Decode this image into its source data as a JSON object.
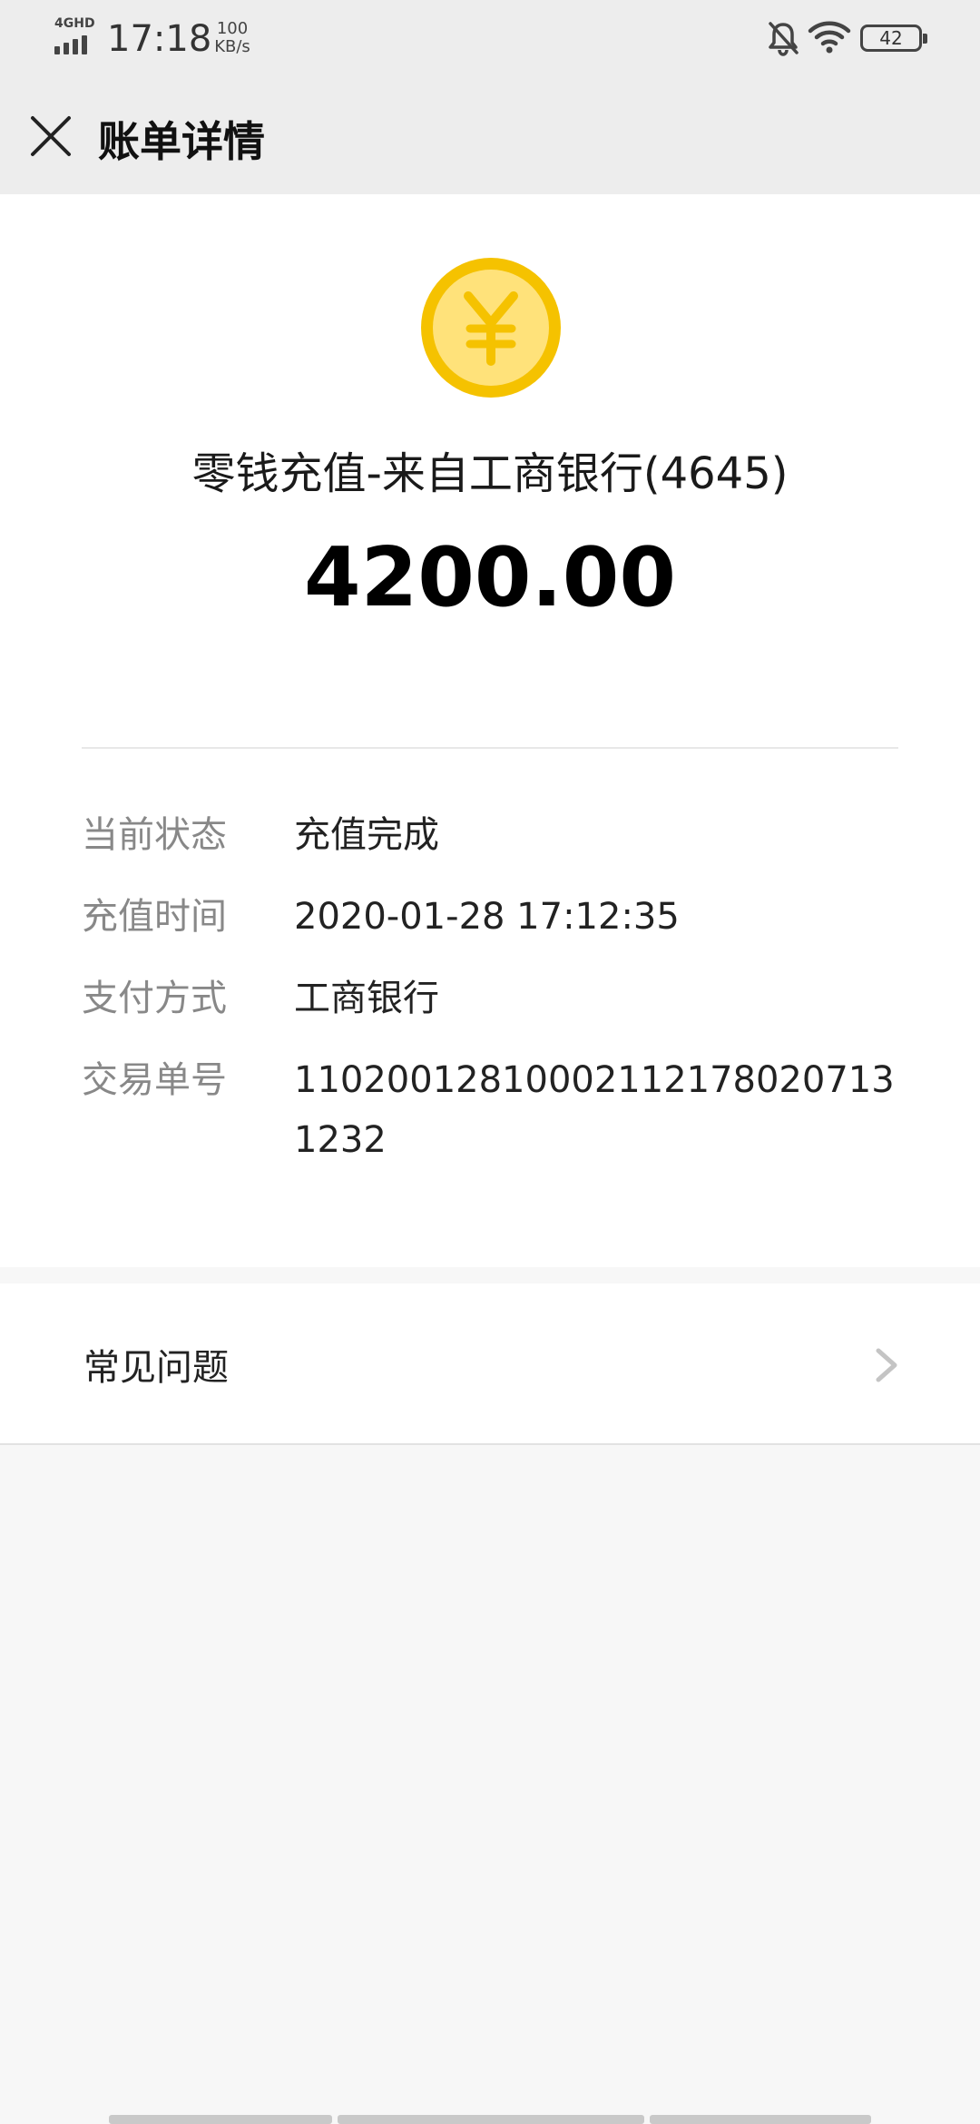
{
  "status_bar": {
    "network": "4GHD",
    "time": "17:18",
    "speed_value": "100",
    "speed_unit": "KB/s",
    "battery": "42"
  },
  "header": {
    "title": "账单详情",
    "close_icon": "close-icon"
  },
  "bill": {
    "icon": "yuan-coin-icon",
    "merchant": "零钱充值-来自工商银行(4645)",
    "amount": "4200.00",
    "details": [
      {
        "label": "当前状态",
        "value": "充值完成"
      },
      {
        "label": "充值时间",
        "value": "2020-01-28 17:12:35"
      },
      {
        "label": "支付方式",
        "value": "工商银行"
      },
      {
        "label": "交易单号",
        "value": "110200128100021121780207131232"
      }
    ]
  },
  "faq": {
    "label": "常见问题",
    "icon": "chevron-right-icon"
  },
  "colors": {
    "coin_outer": "#f5c200",
    "coin_inner": "#ffe27a",
    "header_bg": "#ededed",
    "page_bg": "#f7f7f7"
  }
}
